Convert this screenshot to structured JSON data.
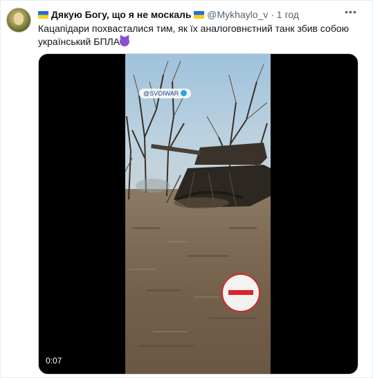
{
  "tweet": {
    "author_name": "Дякую Богу, що я не москаль",
    "handle": "@Mykhaylo_v",
    "separator": "·",
    "time": "1 год",
    "more_icon": "more-dots-icon",
    "text": "Кацапідари похвасталися тим, як їх аналоговнєтний танк збив собою український БПЛА",
    "flag_icon": "ukraine-flag-icon",
    "emoji": "smiling-devil-emoji"
  },
  "media": {
    "watermark": "@SVOIWAR",
    "duration": "0:07",
    "badge_icon": "channel-logo-badge",
    "colors": {
      "frame_bg": "#000000",
      "badge_red": "#d7262c"
    }
  }
}
